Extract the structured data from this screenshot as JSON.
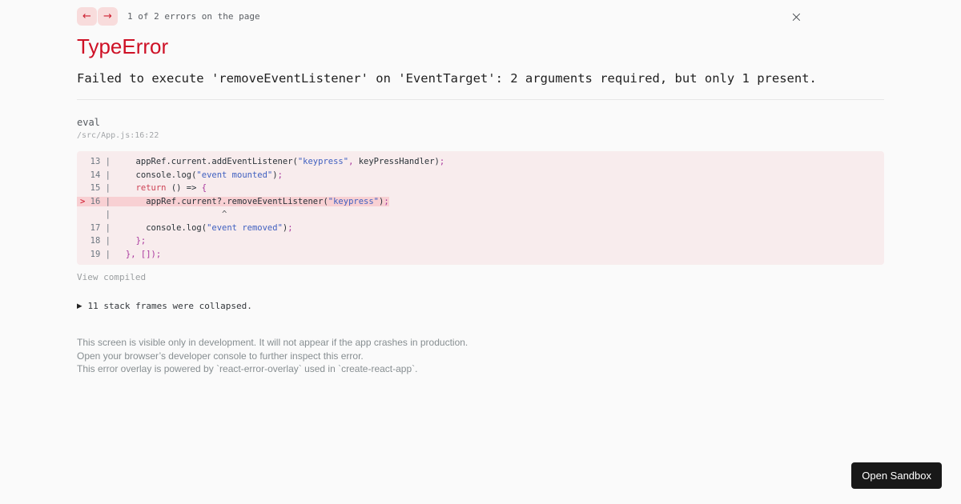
{
  "colors": {
    "accent_red": "#ce1126",
    "page_bg": "#fafafa",
    "code_bg": "#f8eced",
    "highlight_bg": "#f8d0d3",
    "nav_button_bg": "#f8dcdc",
    "sandbox_button_bg": "#181818",
    "tokens": {
      "g": "#6c7680",
      "d": "#293238",
      "s": "#4060c0",
      "k": "#cd4255",
      "p": "#a8359c",
      "m": "#ce1126",
      "c": "#56595c"
    }
  },
  "nav": {
    "prev_label": "←",
    "next_label": "→",
    "counter": "1 of 2 errors on the page",
    "close_label": "×"
  },
  "error": {
    "name": "TypeError",
    "message": "Failed to execute 'removeEventListener' on 'EventTarget': 2 arguments required, but only 1 present."
  },
  "frame": {
    "function": "eval",
    "location": "/src/App.js:16:22"
  },
  "code": {
    "lines": [
      {
        "highlight": false,
        "segments": [
          {
            "t": "  13 | ",
            "c": "g"
          },
          {
            "t": "    appRef.current.addEventListener(",
            "c": "d"
          },
          {
            "t": "\"keypress\"",
            "c": "s"
          },
          {
            "t": ",",
            "c": "p"
          },
          {
            "t": " keyPressHandler)",
            "c": "d"
          },
          {
            "t": ";",
            "c": "p"
          }
        ]
      },
      {
        "highlight": false,
        "segments": [
          {
            "t": "  14 | ",
            "c": "g"
          },
          {
            "t": "    console.log(",
            "c": "d"
          },
          {
            "t": "\"event mounted\"",
            "c": "s"
          },
          {
            "t": ")",
            "c": "d"
          },
          {
            "t": ";",
            "c": "p"
          }
        ]
      },
      {
        "highlight": false,
        "segments": [
          {
            "t": "  15 | ",
            "c": "g"
          },
          {
            "t": "    ",
            "c": "d"
          },
          {
            "t": "return",
            "c": "k"
          },
          {
            "t": " () => ",
            "c": "d"
          },
          {
            "t": "{",
            "c": "p"
          }
        ]
      },
      {
        "highlight": true,
        "segments": [
          {
            "t": "> ",
            "c": "m"
          },
          {
            "t": "16 | ",
            "c": "g"
          },
          {
            "t": "      appRef.current?.removeEventListener(",
            "c": "d"
          },
          {
            "t": "\"keypress\"",
            "c": "s"
          },
          {
            "t": ")",
            "c": "d"
          },
          {
            "t": ";",
            "c": "p"
          }
        ]
      },
      {
        "highlight": false,
        "segments": [
          {
            "t": "     | ",
            "c": "g"
          },
          {
            "t": "                     ^",
            "c": "c"
          }
        ]
      },
      {
        "highlight": false,
        "segments": [
          {
            "t": "  17 | ",
            "c": "g"
          },
          {
            "t": "      console.log(",
            "c": "d"
          },
          {
            "t": "\"event removed\"",
            "c": "s"
          },
          {
            "t": ")",
            "c": "d"
          },
          {
            "t": ";",
            "c": "p"
          }
        ]
      },
      {
        "highlight": false,
        "segments": [
          {
            "t": "  18 | ",
            "c": "g"
          },
          {
            "t": "    ",
            "c": "d"
          },
          {
            "t": "};",
            "c": "p"
          }
        ]
      },
      {
        "highlight": false,
        "segments": [
          {
            "t": "  19 | ",
            "c": "g"
          },
          {
            "t": "  ",
            "c": "d"
          },
          {
            "t": "},",
            "c": "p"
          },
          {
            "t": " ",
            "c": "d"
          },
          {
            "t": "[]);",
            "c": "p"
          }
        ]
      }
    ]
  },
  "links": {
    "view_compiled": "View compiled"
  },
  "stack": {
    "toggle_icon": "▶",
    "label": "11 stack frames were collapsed."
  },
  "footer": {
    "lines": [
      "This screen is visible only in development. It will not appear if the app crashes in production.",
      "Open your browser’s developer console to further inspect this error.",
      "This error overlay is powered by `react-error-overlay` used in `create-react-app`."
    ]
  },
  "sandbox": {
    "button_label": "Open Sandbox"
  }
}
